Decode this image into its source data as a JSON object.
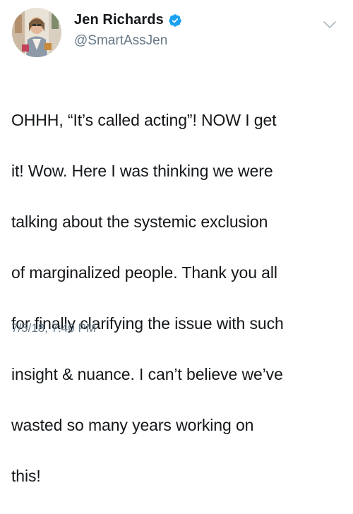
{
  "tweet": {
    "author": {
      "display_name": "Jen Richards",
      "handle": "@SmartAssJen",
      "verified": true,
      "verified_icon": "verified-badge-icon"
    },
    "menu_icon": "chevron-down-icon",
    "text_lines": [
      "OHHH, “It’s called acting”! NOW I get",
      "it! Wow. Here I was thinking we were",
      "talking about the systemic exclusion",
      "of marginalized people. Thank you all",
      "for finally clarifying the issue with such",
      "insight & nuance. I can’t believe we’ve",
      "wasted so many years working on",
      "this!"
    ],
    "timestamp": "7/5/18, 7:40 PM"
  },
  "colors": {
    "text_primary": "#14171a",
    "text_secondary": "#657786",
    "verified_blue": "#1da1f2",
    "caret_gray": "#aab8c2"
  }
}
